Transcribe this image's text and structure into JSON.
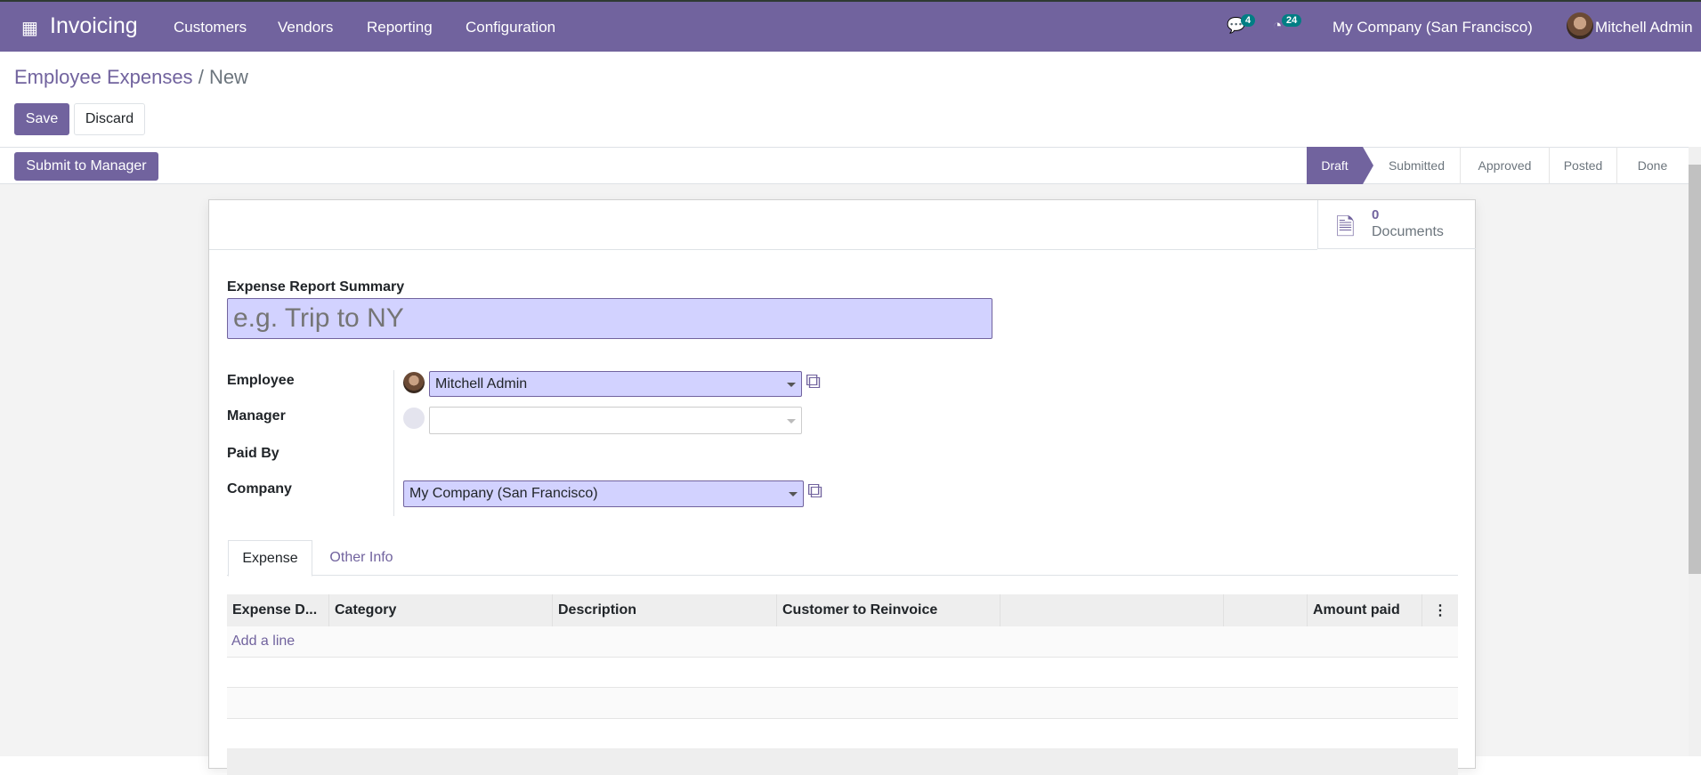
{
  "navbar": {
    "app_name": "Invoicing",
    "menu": [
      "Customers",
      "Vendors",
      "Reporting",
      "Configuration"
    ],
    "messages_count": "4",
    "activities_count": "24",
    "company": "My Company (San Francisco)",
    "user": "Mitchell Admin",
    "color": "#71639e"
  },
  "breadcrumb": {
    "parent": "Employee Expenses",
    "separator": "/",
    "current": "New"
  },
  "buttons": {
    "save": "Save",
    "discard": "Discard",
    "submit": "Submit to Manager"
  },
  "statusbar": {
    "steps": [
      "Draft",
      "Submitted",
      "Approved",
      "Posted",
      "Done"
    ],
    "active": "Draft"
  },
  "smart_button": {
    "count": "0",
    "label": "Documents"
  },
  "form": {
    "summary_label": "Expense Report Summary",
    "summary_placeholder": "e.g. Trip to NY",
    "employee_label": "Employee",
    "employee_value": "Mitchell Admin",
    "manager_label": "Manager",
    "manager_value": "",
    "paid_by_label": "Paid By",
    "company_label": "Company",
    "company_value": "My Company (San Francisco)"
  },
  "tabs": [
    "Expense",
    "Other Info"
  ],
  "table": {
    "columns": [
      "Expense D...",
      "Category",
      "Description",
      "Customer to Reinvoice",
      "",
      "",
      "Amount paid"
    ],
    "add_line": "Add a line"
  }
}
